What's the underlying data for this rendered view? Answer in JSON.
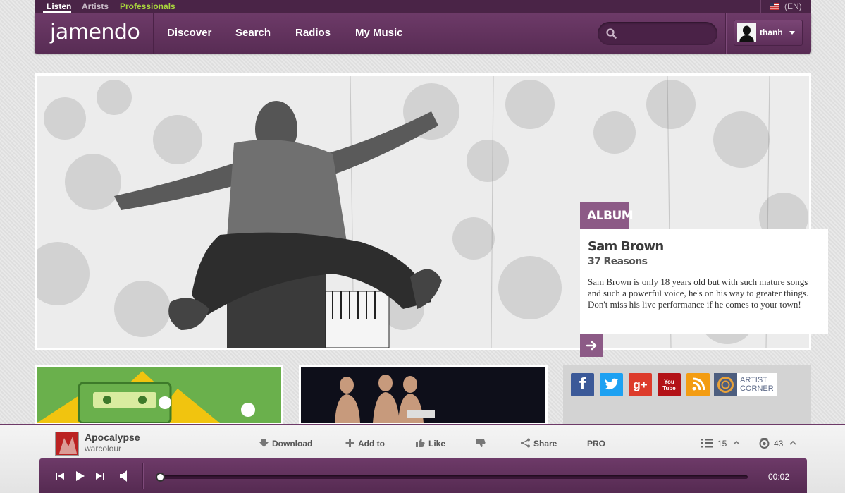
{
  "topbar": {
    "links": [
      "Listen",
      "Artists",
      "Professionals"
    ],
    "active": "Listen",
    "language": "(EN)"
  },
  "header": {
    "logo": "jamendo",
    "nav": [
      "Discover",
      "Search",
      "Radios",
      "My Music"
    ],
    "search": {
      "value": "",
      "placeholder": ""
    },
    "user": {
      "name": "thanh"
    }
  },
  "hero": {
    "tag": "ALBUM",
    "artist": "Sam Brown",
    "title": "37 Reasons",
    "description": "Sam Brown is only 18 years old but with such mature songs and such a powerful voice, he's on his way to greater things. Don't miss his live performance if he comes to your town!",
    "next_icon": "arrow-right-icon"
  },
  "social": {
    "icons": [
      "facebook-icon",
      "twitter-icon",
      "google-plus-icon",
      "youtube-icon",
      "rss-icon"
    ],
    "labels": [
      "f",
      "",
      "g+",
      "You Tube",
      ""
    ],
    "artist_corner": {
      "line1": "ARTIST",
      "line2": "CORNER"
    }
  },
  "player": {
    "track_title": "Apocalypse",
    "track_artist": "warcolour",
    "actions": [
      "Download",
      "Add to",
      "Like",
      "",
      "Share",
      "PRO"
    ],
    "playlist_count": "15",
    "radio_count": "43",
    "time": "00:02",
    "progress": 0.0,
    "colors": {
      "accent": "#6d3a68",
      "pro_green": "#a9d63d"
    }
  }
}
